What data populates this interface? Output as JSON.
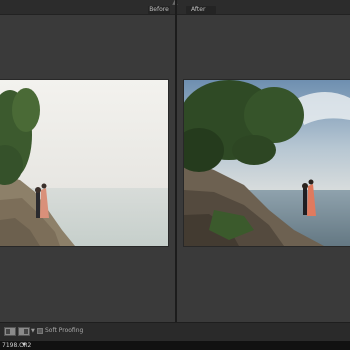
{
  "compare_view": {
    "before_label": "Before",
    "after_label": "After"
  },
  "toolbar": {
    "soft_proofing_label": "Soft Proofing",
    "soft_proofing_checked": false,
    "view_mode_icon_1": "before-after-left-right-icon",
    "view_mode_icon_2": "before-after-split-icon"
  },
  "statusbar": {
    "text": "7198.CR2"
  },
  "colors": {
    "panel_bg": "#3a3a3a",
    "toolbar_bg": "#2a2a2a",
    "divider": "#1c1c1c"
  }
}
